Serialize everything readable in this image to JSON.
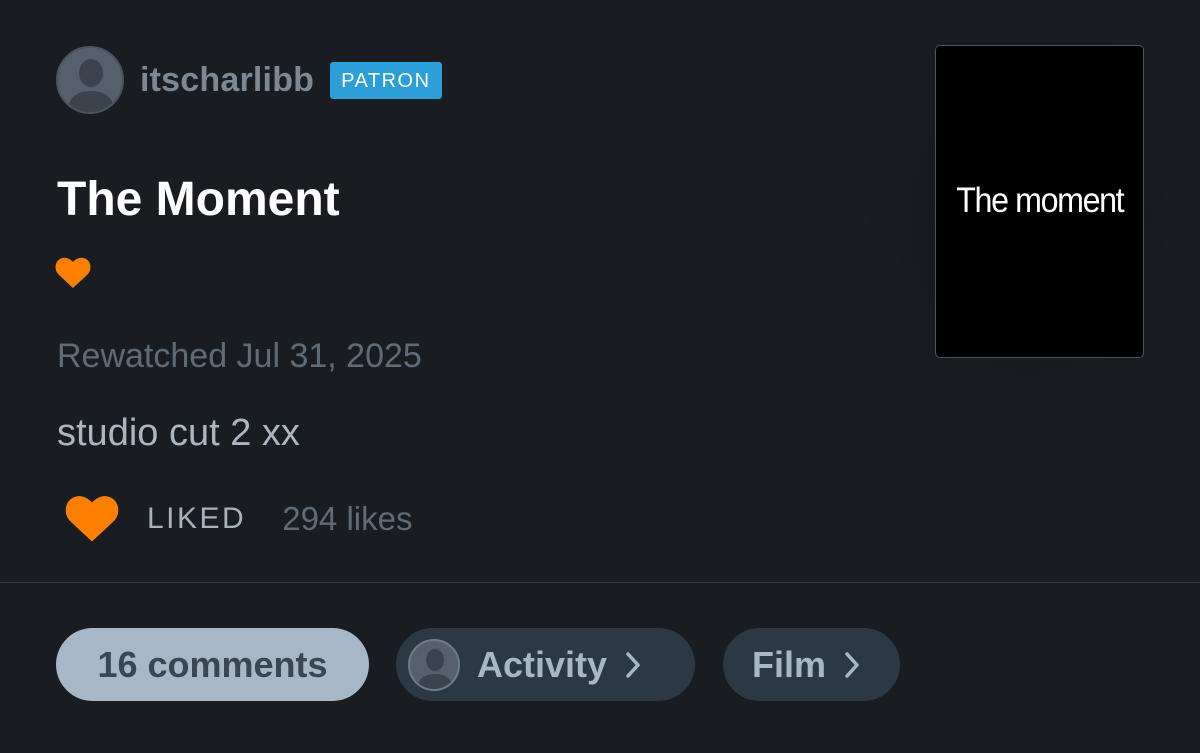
{
  "author": {
    "username": "itscharlibb",
    "badge": "PATRON",
    "avatar_icon": "default-avatar-icon"
  },
  "review": {
    "film_title": "The Moment",
    "liked_film_icon": "heart-icon",
    "status": "Rewatched Jul 31, 2025",
    "text": "studio cut 2 xx"
  },
  "likes": {
    "liked_label": "LIKED",
    "count_text": "294 likes",
    "heart_icon": "heart-icon"
  },
  "poster": {
    "text": "The moment"
  },
  "actions": {
    "comments_label": "16 comments",
    "activity_label": "Activity",
    "film_label": "Film"
  },
  "colors": {
    "background": "#191d22",
    "heart": "#ff8000",
    "patron_badge": "#2c9ed8",
    "pill_dark": "#2b3947",
    "pill_light": "#a6b7c8"
  }
}
